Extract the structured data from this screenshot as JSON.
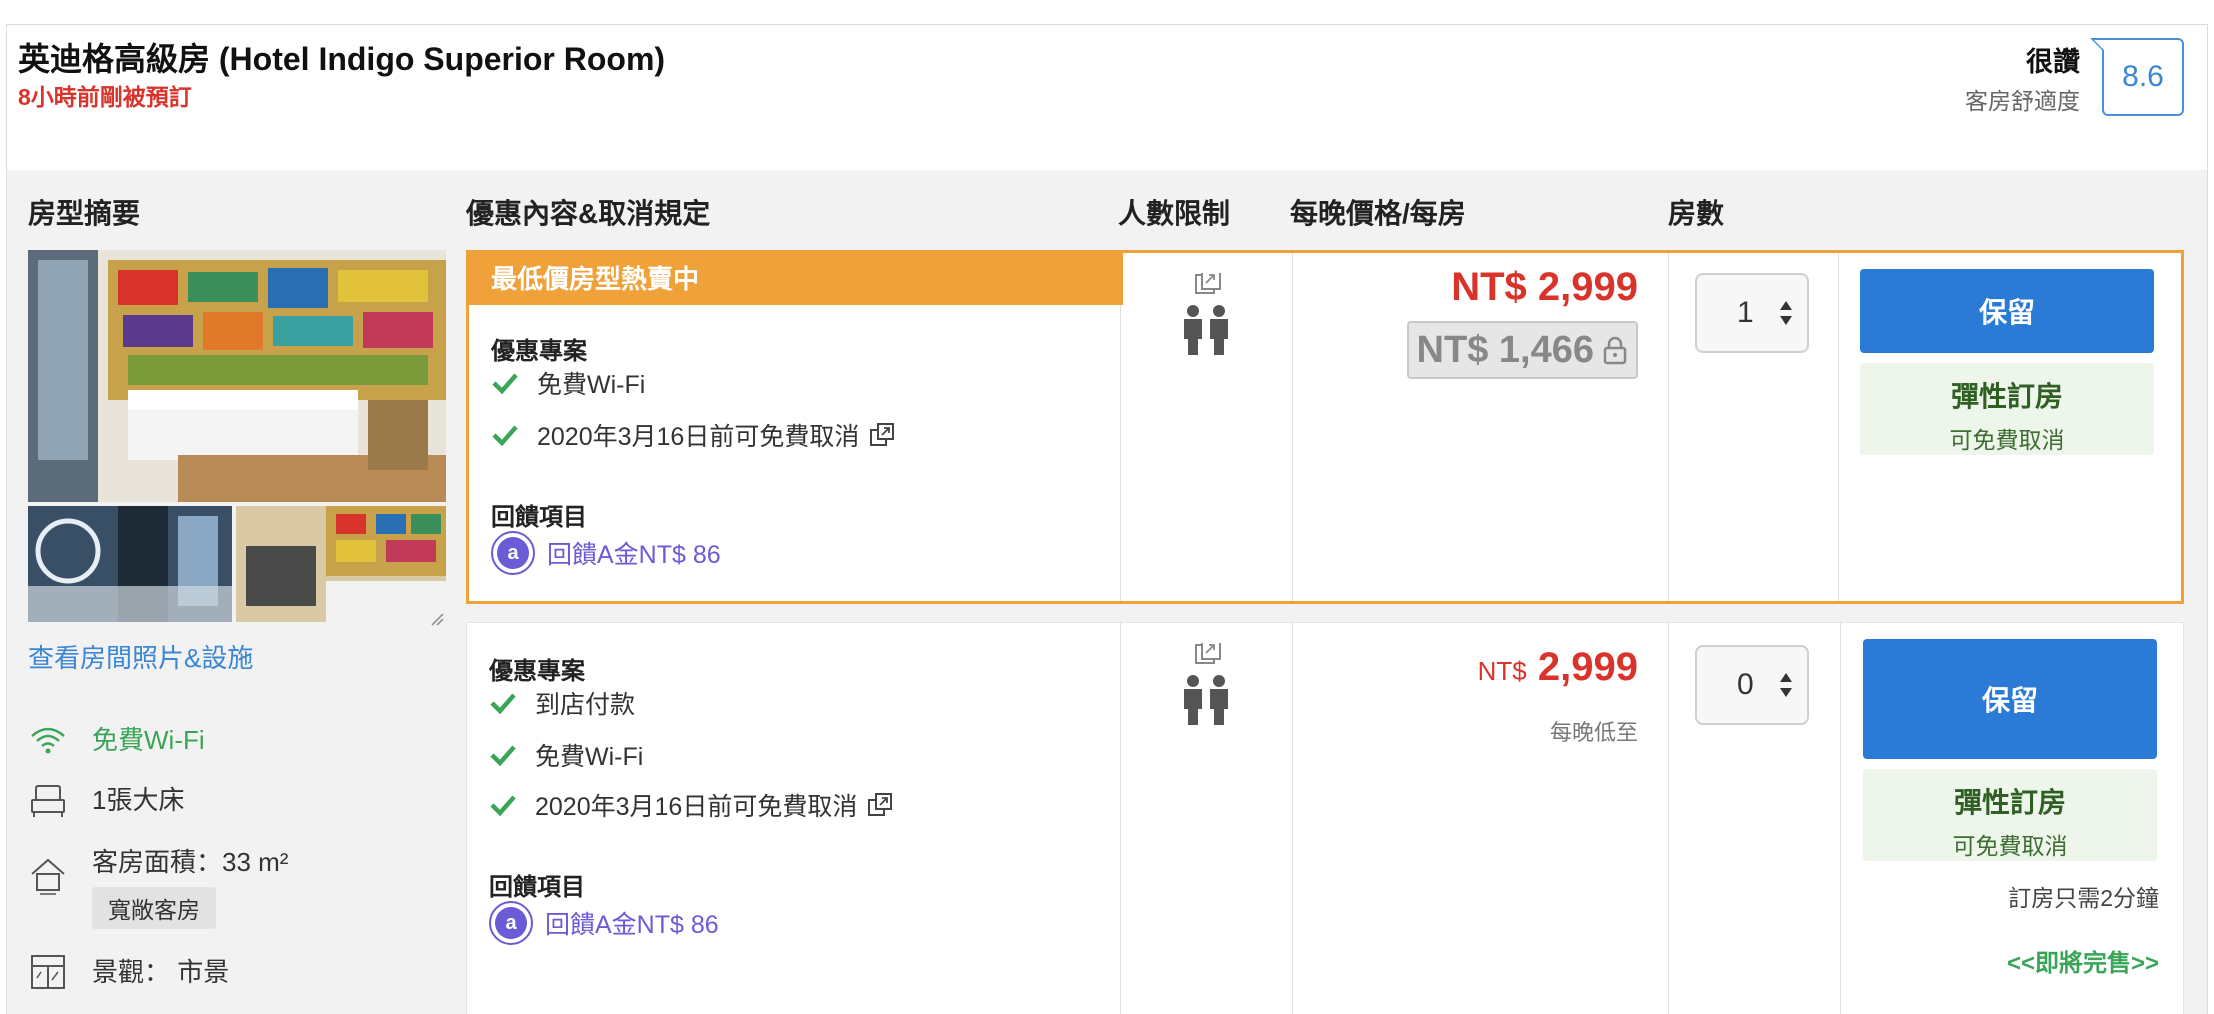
{
  "header": {
    "room_title": "英迪格高級房 (Hotel Indigo Superior Room)",
    "recent_booking": "8小時前剛被預訂",
    "rating_word": "很讚",
    "rating_sub": "客房舒適度",
    "score": "8.6"
  },
  "columns": {
    "summary": "房型摘要",
    "offers": "優惠內容&取消規定",
    "occupancy": "人數限制",
    "price": "每晚價格/每房",
    "rooms": "房數"
  },
  "summary": {
    "photos_link": "查看房間照片&設施",
    "amenities": [
      {
        "icon": "wifi-icon",
        "label": "免費Wi-Fi"
      },
      {
        "icon": "bed-icon",
        "label": "1張大床"
      },
      {
        "icon": "room-size-icon",
        "label": "客房面積：33 m²",
        "tag": "寬敞客房"
      },
      {
        "icon": "window-view-icon",
        "label": "景觀： 市景"
      }
    ]
  },
  "offers": [
    {
      "banner": "最低價房型熱賣中",
      "deal_title": "優惠專案",
      "features": [
        "免費Wi-Fi",
        "2020年3月16日前可免費取消"
      ],
      "reward_title": "回饋項目",
      "reward": "回饋A金NT$ 86",
      "price": "NT$ 2,999",
      "member_price": "NT$ 1,466",
      "quantity": "1",
      "keep_label": "保留",
      "flex_title": "彈性訂房",
      "flex_sub": "可免費取消"
    },
    {
      "deal_title": "優惠專案",
      "features": [
        "到店付款",
        "免費Wi-Fi",
        "2020年3月16日前可免費取消"
      ],
      "reward_title": "回饋項目",
      "reward": "回饋A金NT$ 86",
      "price_currency": "NT$",
      "price_amount": "2,999",
      "price_note": "每晚低至",
      "quantity": "0",
      "keep_label": "保留",
      "flex_title": "彈性訂房",
      "flex_sub": "可免費取消",
      "booking_time": "訂房只需2分鐘",
      "selling_out": "<<即將完售>>"
    }
  ],
  "colors": {
    "accent_orange": "#f0a23a",
    "primary_blue": "#2b7bd6",
    "price_red": "#d9342b",
    "reward_purple": "#6b5bd6",
    "check_green": "#3aa557"
  }
}
